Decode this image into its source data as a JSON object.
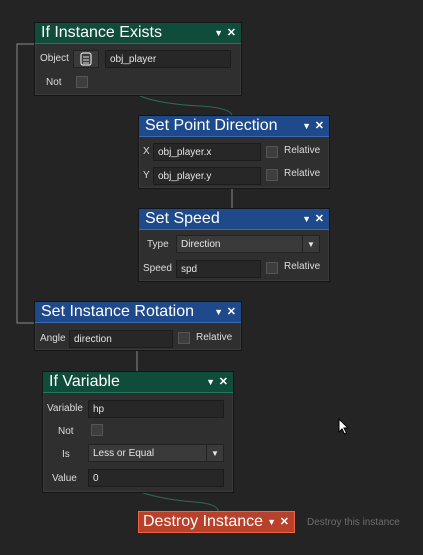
{
  "if_instance_exists": {
    "title": "If Instance Exists",
    "object_label": "Object",
    "object_value": "obj_player",
    "not_label": "Not"
  },
  "set_point_direction": {
    "title": "Set Point Direction",
    "x_label": "X",
    "x_value": "obj_player.x",
    "y_label": "Y",
    "y_value": "obj_player.y",
    "relative_label": "Relative"
  },
  "set_speed": {
    "title": "Set Speed",
    "type_label": "Type",
    "type_value": "Direction",
    "speed_label": "Speed",
    "speed_value": "spd",
    "relative_label": "Relative"
  },
  "set_instance_rotation": {
    "title": "Set Instance Rotation",
    "angle_label": "Angle",
    "angle_value": "direction",
    "relative_label": "Relative"
  },
  "if_variable": {
    "title": "If Variable",
    "variable_label": "Variable",
    "variable_value": "hp",
    "not_label": "Not",
    "is_label": "Is",
    "is_value": "Less or Equal",
    "value_label": "Value",
    "value_value": "0"
  },
  "destroy_instance": {
    "title": "Destroy Instance",
    "hint": "Destroy this instance"
  },
  "icons": {
    "caret": "chevron-down-icon",
    "close": "close-icon",
    "object_picker": "object-picker-icon",
    "cursor": "mouse-cursor-icon"
  },
  "colors": {
    "background": "#242424",
    "condition_header": "#0f4d3a",
    "action_header": "#1e4a8c",
    "destroy_header": "#b8412b",
    "connector": "#2e6b55"
  }
}
